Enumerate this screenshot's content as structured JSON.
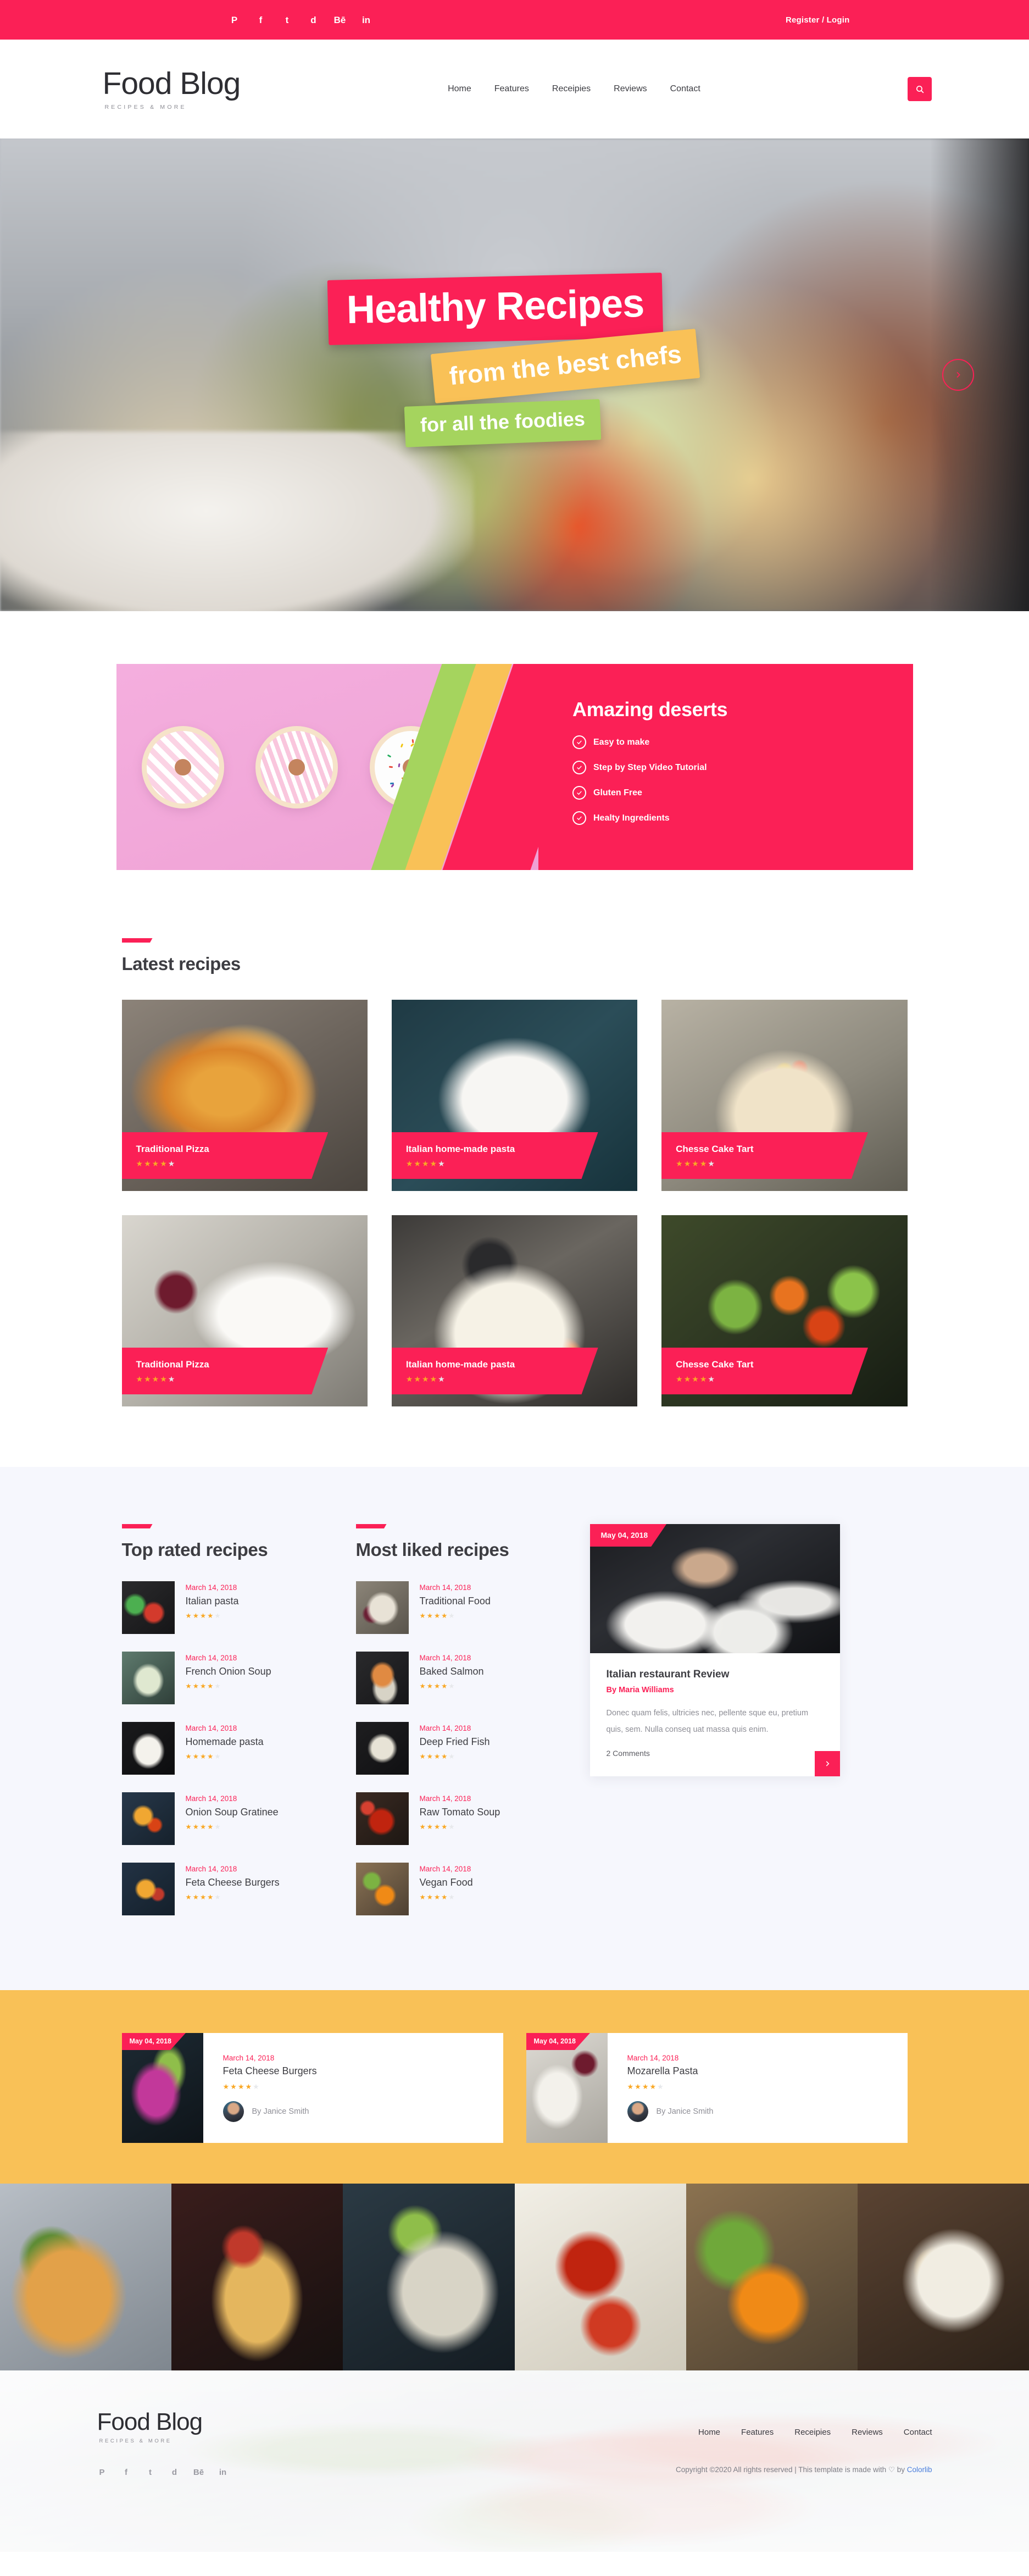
{
  "topbar": {
    "social": [
      {
        "name": "pinterest-icon",
        "glyph": "P"
      },
      {
        "name": "facebook-icon",
        "glyph": "f"
      },
      {
        "name": "twitter-icon",
        "glyph": "t"
      },
      {
        "name": "dribbble-icon",
        "glyph": "d"
      },
      {
        "name": "behance-icon",
        "glyph": "Bē"
      },
      {
        "name": "linkedin-icon",
        "glyph": "in"
      }
    ],
    "register_label": "Register / Login"
  },
  "header": {
    "logo_title": "Food Blog",
    "logo_subtitle": "RECIPES & MORE",
    "nav": [
      "Home",
      "Features",
      "Receipies",
      "Reviews",
      "Contact"
    ],
    "search_icon": "search-icon"
  },
  "hero": {
    "line1": "Healthy Recipes",
    "line2": "from the best chefs",
    "line3": "for all the foodies",
    "next_icon": "chevron-right-icon"
  },
  "promo": {
    "title": "Amazing deserts",
    "features": [
      "Easy to make",
      "Step by Step Video Tutorial",
      "Gluten Free",
      "Healty Ingredients"
    ]
  },
  "latest": {
    "title": "Latest recipes",
    "cards": [
      {
        "name": "Traditional Pizza",
        "rating": 4,
        "photo": "ph-pizza"
      },
      {
        "name": "Italian home-made pasta",
        "rating": 4,
        "photo": "ph-pasta"
      },
      {
        "name": "Chesse Cake Tart",
        "rating": 4,
        "photo": "ph-cake"
      },
      {
        "name": "Traditional Pizza",
        "rating": 4,
        "photo": "ph-wine"
      },
      {
        "name": "Italian home-made pasta",
        "rating": 4,
        "photo": "ph-pie"
      },
      {
        "name": "Chesse Cake Tart",
        "rating": 4,
        "photo": "ph-veg"
      }
    ]
  },
  "top_rated": {
    "title": "Top rated recipes",
    "items": [
      {
        "date": "March 14, 2018",
        "title": "Italian pasta",
        "rating": 4,
        "thumb": "th-a"
      },
      {
        "date": "March 14, 2018",
        "title": "French Onion Soup",
        "rating": 4,
        "thumb": "th-b"
      },
      {
        "date": "March 14, 2018",
        "title": "Homemade pasta",
        "rating": 4,
        "thumb": "th-c"
      },
      {
        "date": "March 14, 2018",
        "title": "Onion Soup Gratinee",
        "rating": 4,
        "thumb": "th-d"
      },
      {
        "date": "March 14, 2018",
        "title": "Feta Cheese Burgers",
        "rating": 4,
        "thumb": "th-e"
      }
    ]
  },
  "most_liked": {
    "title": "Most liked recipes",
    "items": [
      {
        "date": "March 14, 2018",
        "title": "Traditional Food",
        "rating": 4,
        "thumb": "th-f"
      },
      {
        "date": "March 14, 2018",
        "title": "Baked Salmon",
        "rating": 4,
        "thumb": "th-g"
      },
      {
        "date": "March 14, 2018",
        "title": "Deep Fried Fish",
        "rating": 4,
        "thumb": "th-h"
      },
      {
        "date": "March 14, 2018",
        "title": "Raw Tomato Soup",
        "rating": 4,
        "thumb": "th-i"
      },
      {
        "date": "March 14, 2018",
        "title": "Vegan Food",
        "rating": 4,
        "thumb": "th-j"
      }
    ]
  },
  "review": {
    "date": "May 04, 2018",
    "title": "Italian restaurant Review",
    "author": "By Maria Williams",
    "text": "Donec quam felis, ultricies nec, pellente sque eu, pretium quis, sem. Nulla conseq uat massa quis enim.",
    "comments": "2 Comments",
    "next_icon": "chevron-right-icon"
  },
  "featured": [
    {
      "badge_date": "May 04, 2018",
      "date": "March 14, 2018",
      "title": "Feta Cheese Burgers",
      "rating": 4,
      "author": "By Janice Smith",
      "photo": "yc-cabbage"
    },
    {
      "badge_date": "May 04, 2018",
      "date": "March 14, 2018",
      "title": "Mozarella Pasta",
      "rating": 4,
      "author": "By Janice Smith",
      "photo": "yc-pasta"
    }
  ],
  "gallery": [
    {
      "name": "gallery-item-pizza",
      "cls": "g1"
    },
    {
      "name": "gallery-item-grill",
      "cls": "g2"
    },
    {
      "name": "gallery-item-mussels",
      "cls": "g3"
    },
    {
      "name": "gallery-item-tomato-soup",
      "cls": "g4"
    },
    {
      "name": "gallery-item-oranges",
      "cls": "g5"
    },
    {
      "name": "gallery-item-salad",
      "cls": "g6"
    }
  ],
  "footer": {
    "logo_title": "Food Blog",
    "logo_subtitle": "RECIPES & MORE",
    "nav": [
      "Home",
      "Features",
      "Receipies",
      "Reviews",
      "Contact"
    ],
    "copyright_before": "Copyright ©2020 All rights reserved | This template is made with ",
    "heart": "♡",
    "copyright_mid": " by ",
    "brand": "Colorlib",
    "social": [
      {
        "name": "pinterest-icon",
        "glyph": "P"
      },
      {
        "name": "facebook-icon",
        "glyph": "f"
      },
      {
        "name": "twitter-icon",
        "glyph": "t"
      },
      {
        "name": "dribbble-icon",
        "glyph": "d"
      },
      {
        "name": "behance-icon",
        "glyph": "Bē"
      },
      {
        "name": "linkedin-icon",
        "glyph": "in"
      }
    ]
  },
  "colors": {
    "accent": "#fb2056",
    "yellow": "#f9c157",
    "green": "#a5d45e",
    "star": "#f9a825",
    "light_bg": "#f6f7fd"
  }
}
